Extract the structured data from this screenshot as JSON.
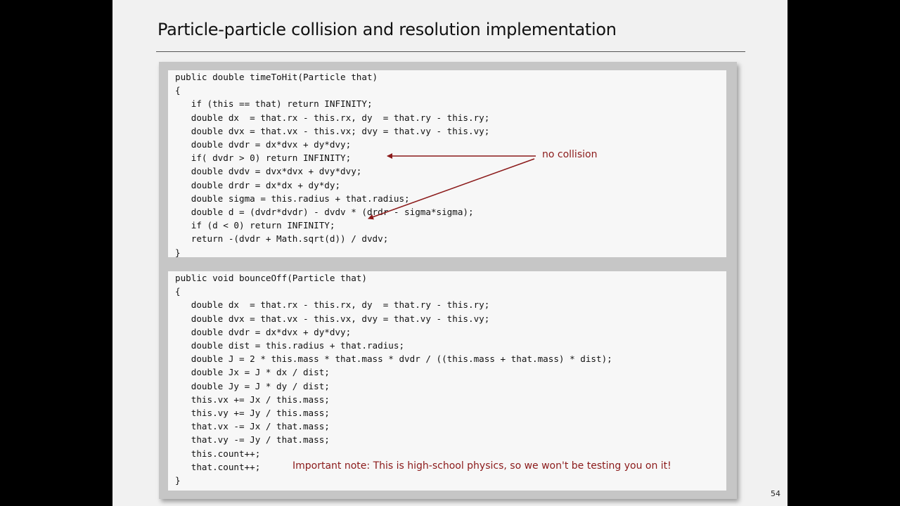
{
  "slide": {
    "title": "Particle-particle collision and resolution implementation",
    "page_number": "54"
  },
  "time_to_hit": {
    "lines": [
      "public double timeToHit(Particle that)",
      "{",
      "   if (this == that) return INFINITY;",
      "   double dx  = that.rx - this.rx, dy  = that.ry - this.ry;",
      "   double dvx = that.vx - this.vx; dvy = that.vy - this.vy;",
      "   double dvdr = dx*dvx + dy*dvy;",
      "   if( dvdr > 0) return INFINITY;",
      "   double dvdv = dvx*dvx + dvy*dvy;",
      "   double drdr = dx*dx + dy*dy;",
      "   double sigma = this.radius + that.radius;",
      "   double d = (dvdr*dvdr) - dvdv * (drdr - sigma*sigma);",
      "   if (d < 0) return INFINITY;",
      "   return -(dvdr + Math.sqrt(d)) / dvdv;",
      "}"
    ]
  },
  "bounce_off": {
    "lines": [
      "public void bounceOff(Particle that)",
      "{",
      "   double dx  = that.rx - this.rx, dy  = that.ry - this.ry;",
      "   double dvx = that.vx - this.vx, dvy = that.vy - this.vy;",
      "   double dvdr = dx*dvx + dy*dvy;",
      "   double dist = this.radius + that.radius;",
      "   double J = 2 * this.mass * that.mass * dvdr / ((this.mass + that.mass) * dist);",
      "   double Jx = J * dx / dist;",
      "   double Jy = J * dy / dist;",
      "   this.vx += Jx / this.mass;",
      "   this.vy += Jy / this.mass;",
      "   that.vx -= Jx / that.mass;",
      "   that.vy -= Jy / that.mass;",
      "   this.count++;",
      "   that.count++;",
      "}"
    ]
  },
  "annotations": {
    "no_collision": "no collision",
    "important_note": "Important note: This is high-school physics, so we won't be testing you on it!"
  },
  "colors": {
    "accent": "#8b1a1a",
    "background": "#000000",
    "slide": "#f1f1f1"
  }
}
